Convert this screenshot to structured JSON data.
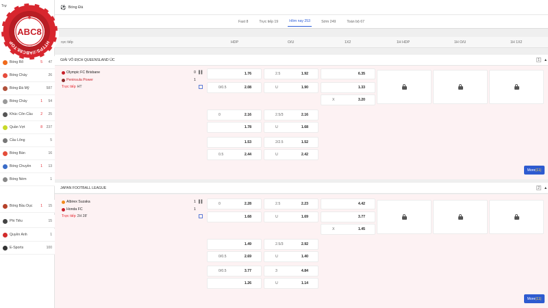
{
  "brand": {
    "name": "ABC8",
    "url": "HTTPS://ABC88.TOP"
  },
  "topbar": {
    "title": "Bóng Đá",
    "cut_text": "Trự"
  },
  "tabs": [
    {
      "label": "Fast 8"
    },
    {
      "label": "Trực tiếp 19"
    },
    {
      "label": "Hôm nay 253"
    },
    {
      "label": "Sớm 249"
    },
    {
      "label": "Toàn bộ 67"
    }
  ],
  "columns": {
    "live": "rực tiếp",
    "hdp": "HDP",
    "ou": "O/U",
    "x12": "1X2",
    "h1hdp": "1H HDP",
    "h1ou": "1H O/U",
    "h1x12": "1H 1X2"
  },
  "sidebar": {
    "items": [
      {
        "label": "Bóng Rổ",
        "live": "5",
        "count": "47",
        "icon_color": "#f06a1b"
      },
      {
        "label": "Bóng Chày",
        "live": "",
        "count": "26",
        "icon_color": "#e64b3c"
      },
      {
        "label": "Bóng Đá Mỹ",
        "live": "",
        "count": "587",
        "icon_color": "#b0503a"
      },
      {
        "label": "Bóng Chày",
        "live": "1",
        "count": "54",
        "icon_color": "#999999"
      },
      {
        "label": "Khúc Côn Cầu",
        "live": "2",
        "count": "25",
        "icon_color": "#555555"
      },
      {
        "label": "Quần Vợt",
        "live": "8",
        "count": "237",
        "icon_color": "#c8d928"
      },
      {
        "label": "Cầu Lông",
        "live": "",
        "count": "5",
        "icon_color": "#777777"
      },
      {
        "label": "Bóng Bàn",
        "live": "",
        "count": "16",
        "icon_color": "#e44d3a"
      },
      {
        "label": "Bóng Chuyền",
        "live": "1",
        "count": "13",
        "icon_color": "#3a6cc8"
      },
      {
        "label": "Bóng Ném",
        "live": "",
        "count": "1",
        "icon_color": "#888888"
      },
      {
        "label": "Bóng Bầu Dục",
        "live": "1",
        "count": "15",
        "icon_color": "#b5412a"
      },
      {
        "label": "Phi Tiêu",
        "live": "",
        "count": "15",
        "icon_color": "#444444"
      },
      {
        "label": "Quyền Anh",
        "live": "",
        "count": "1",
        "icon_color": "#d22b2b"
      },
      {
        "label": "E-Sports",
        "live": "",
        "count": "100",
        "icon_color": "#333333"
      }
    ]
  },
  "leagues": [
    {
      "name": "Giải vô địch Queensland Úc",
      "count": "1",
      "home": "Olympic FC Brisbane",
      "away": "Peninsula Power",
      "home_score": "0",
      "away_score": "1",
      "live_label": "Trực tiếp",
      "time": "HT",
      "more_label": "More",
      "more_count": "(11)",
      "lines": [
        {
          "hdp": [
            {
              "h": "",
              "v": "1.76"
            },
            {
              "h": "0/0.5",
              "v": "2.08"
            }
          ],
          "ou": [
            {
              "h": "2.5",
              "v": "1.92"
            },
            {
              "h": "U",
              "v": "1.90"
            }
          ]
        },
        {
          "hdp": [
            {
              "h": "0",
              "v": "2.16"
            },
            {
              "h": "",
              "v": "1.78"
            }
          ],
          "ou": [
            {
              "h": "2.5/3",
              "v": "2.16"
            },
            {
              "h": "U",
              "v": "1.68"
            }
          ]
        },
        {
          "hdp": [
            {
              "h": "",
              "v": "1.53"
            },
            {
              "h": "0.5",
              "v": "2.44"
            }
          ],
          "ou": [
            {
              "h": "2/2.5",
              "v": "1.52"
            },
            {
              "h": "U",
              "v": "2.42"
            }
          ]
        }
      ],
      "x12": [
        {
          "h": "",
          "v": "6.35"
        },
        {
          "h": "",
          "v": "1.33"
        },
        {
          "h": "X",
          "v": "3.20"
        }
      ]
    },
    {
      "name": "Japan Football League",
      "count": "2",
      "home": "Albirex Suzaka",
      "away": "Honda FC",
      "home_score": "1",
      "away_score": "1",
      "live_label": "Trực tiếp",
      "time": "2H 28'",
      "more_label": "More",
      "more_count": "(11)",
      "lines": [
        {
          "hdp": [
            {
              "h": "0",
              "v": "2.28"
            },
            {
              "h": "",
              "v": "1.68"
            }
          ],
          "ou": [
            {
              "h": "2.5",
              "v": "2.23"
            },
            {
              "h": "U",
              "v": "1.69"
            }
          ]
        },
        {
          "hdp": [
            {
              "h": "",
              "v": "1.49"
            },
            {
              "h": "0/0.5",
              "v": "2.69"
            }
          ],
          "ou": [
            {
              "h": "2.5/3",
              "v": "2.92"
            },
            {
              "h": "U",
              "v": "1.40"
            }
          ]
        },
        {
          "hdp": [
            {
              "h": "0/0.5",
              "v": "3.77"
            },
            {
              "h": "",
              "v": "1.26"
            }
          ],
          "ou": [
            {
              "h": "3",
              "v": "4.84"
            },
            {
              "h": "U",
              "v": "1.14"
            }
          ]
        }
      ],
      "x12": [
        {
          "h": "",
          "v": "4.42"
        },
        {
          "h": "",
          "v": "3.77"
        },
        {
          "h": "X",
          "v": "1.45"
        }
      ]
    }
  ]
}
